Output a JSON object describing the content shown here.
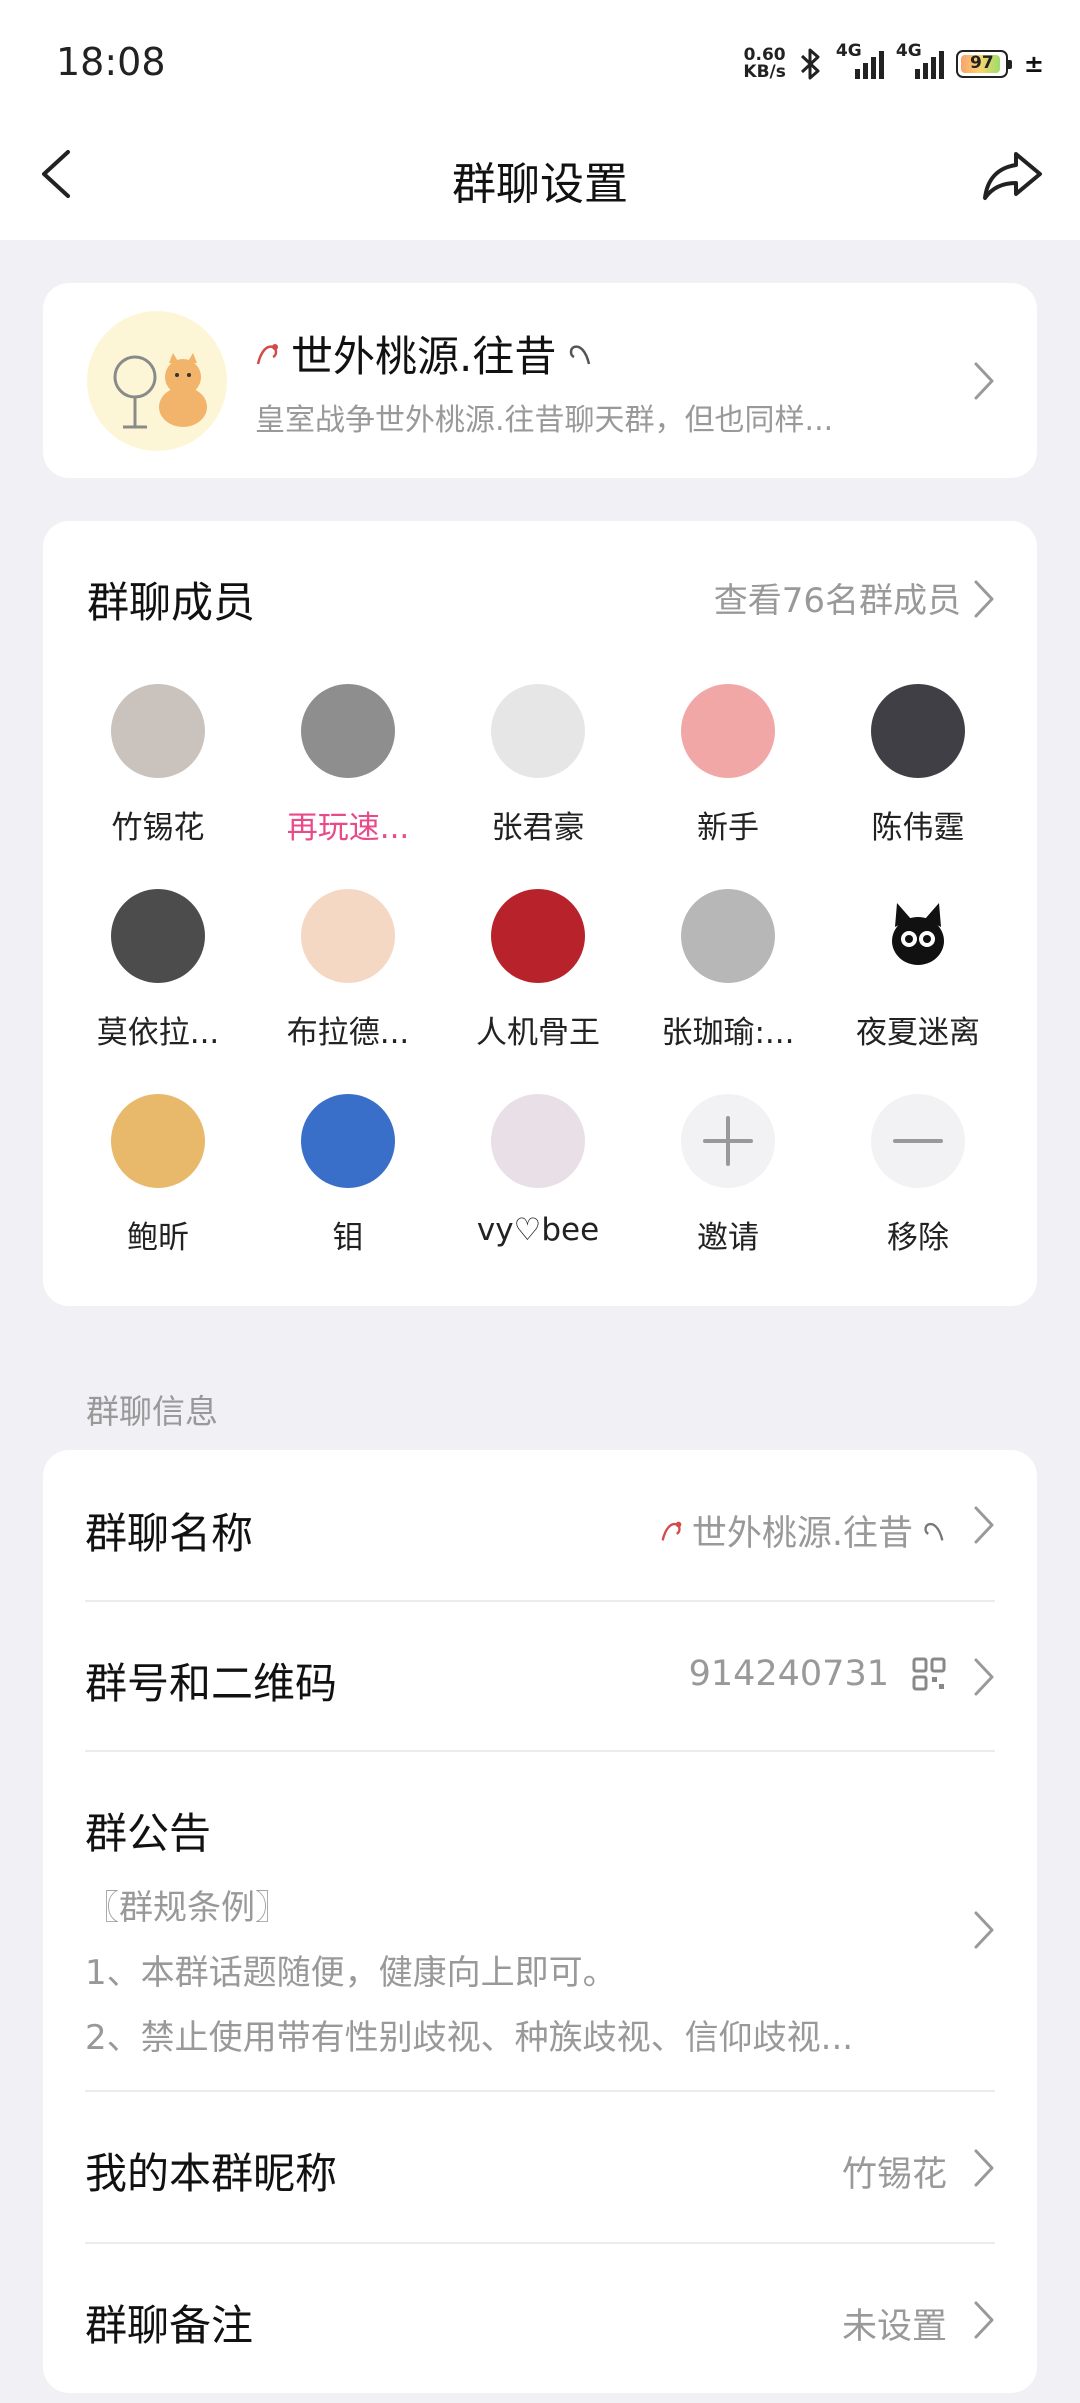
{
  "status_bar": {
    "time": "18:08",
    "net_speed_value": "0.60",
    "net_speed_unit": "KB/s",
    "signal1_label": "4G",
    "signal2_label": "4G",
    "battery_level": "97",
    "charging_symbol": "±"
  },
  "nav": {
    "title": "群聊设置"
  },
  "group_header": {
    "name": "世外桃源.往昔",
    "description": "皇室战争世外桃源.往昔聊天群，但也同样..."
  },
  "members": {
    "title": "群聊成员",
    "view_all": "查看76名群成员",
    "items": [
      {
        "name": "竹锡花",
        "color": "#c9c2bd"
      },
      {
        "name": "再玩速...",
        "color": "#8e8e8e",
        "highlight": true
      },
      {
        "name": "张君豪",
        "color": "#e6e6e6"
      },
      {
        "name": "新手",
        "color": "#f2a7a7"
      },
      {
        "name": "陈伟霆",
        "color": "#3f3f45"
      },
      {
        "name": "莫依拉...",
        "color": "#4c4c4c"
      },
      {
        "name": "布拉德...",
        "color": "#f5d8c4"
      },
      {
        "name": "人机骨王",
        "color": "#b8232b"
      },
      {
        "name": "张珈瑜:...",
        "color": "#b7b7b7"
      },
      {
        "name": "夜夏迷离",
        "color": "#111111"
      },
      {
        "name": "鲍昕",
        "color": "#e9b96b"
      },
      {
        "name": "钼",
        "color": "#3a6fc9"
      },
      {
        "name": "vy♡bee",
        "color": "#e9dfe6"
      }
    ],
    "invite_label": "邀请",
    "remove_label": "移除"
  },
  "info_section": {
    "label": "群聊信息",
    "group_name_label": "群聊名称",
    "group_name_value": "世外桃源.往昔",
    "group_id_label": "群号和二维码",
    "group_id_value": "914240731",
    "notice_label": "群公告",
    "notice_lines": [
      "〖群规条例〗",
      "1、本群话题随便，健康向上即可。",
      "2、禁止使用带有性别歧视、种族歧视、信仰歧视..."
    ],
    "nickname_label": "我的本群昵称",
    "nickname_value": "竹锡花",
    "remark_label": "群聊备注",
    "remark_value": "未设置"
  }
}
